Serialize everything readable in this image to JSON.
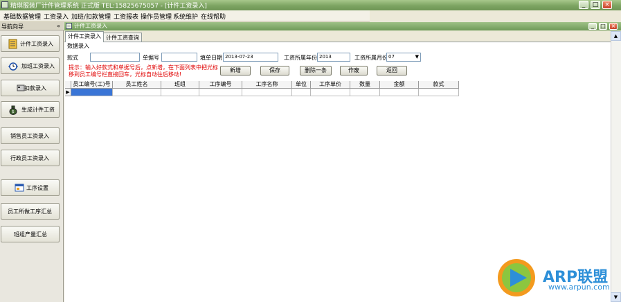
{
  "window": {
    "title": "精琪服装厂计件管理系统 正式版 TEL:15825675057 - [计件工资录入]",
    "controls": [
      "_",
      "□",
      "×"
    ]
  },
  "menu": [
    "基础数据管理",
    "工资录入",
    "加班/扣款管理",
    "工资报表",
    "操作员管理",
    "系统维护",
    "在线帮助"
  ],
  "sidebar": {
    "title": "导航向导",
    "collapse": "«",
    "items": [
      {
        "label": "计件工资录入",
        "icon": "ledger-icon"
      },
      {
        "label": "加班工资录入",
        "icon": "clock-arrows-icon"
      },
      {
        "label": "扣款录入",
        "icon": "card-icon"
      },
      {
        "label": "生成计件工资",
        "icon": "money-bag-icon"
      },
      {
        "label": "销售员工资录入",
        "icon": ""
      },
      {
        "label": "行政员工资录入",
        "icon": ""
      },
      {
        "label": "工序设置",
        "icon": "settings-window-icon"
      },
      {
        "label": "员工所做工序汇总",
        "icon": ""
      },
      {
        "label": "班组产量汇总",
        "icon": ""
      }
    ]
  },
  "inner_window": {
    "title": "计件工资录入",
    "controls": [
      "_",
      "□",
      "×"
    ]
  },
  "tabs": [
    {
      "label": "计件工资录入",
      "active": true
    },
    {
      "label": "计件工资查询",
      "active": false
    }
  ],
  "group_label": "数据录入",
  "form": {
    "style_label": "款式",
    "style_value": "",
    "doc_no_label": "单据号",
    "doc_no_value": "",
    "date_label": "填单日期",
    "date_value": "2013-07-23",
    "year_label": "工资所属年份",
    "year_value": "2013",
    "month_label": "工资所属月份",
    "month_value": "07"
  },
  "hint": "提示：输入好款式和单据号后，点新增，在下面列表中把光标移到员工编号栏直接回车，光标自动往后移动!",
  "buttons": [
    "新增",
    "保存",
    "删除一条",
    "作废",
    "返回"
  ],
  "table": {
    "columns": [
      "员工编号(工)号",
      "员工姓名",
      "班组",
      "工序编号",
      "工序名称",
      "单位",
      "工序单价",
      "数量",
      "金额",
      "款式"
    ],
    "row_marker": "▶"
  },
  "watermark": {
    "title": "ARP联盟",
    "url": "www.arpun.com",
    "colors": {
      "blue": "#2d8fd8",
      "orange": "#f39a1e",
      "green": "#8cc63f"
    }
  },
  "colors": {
    "titlebar": "#7da462",
    "hint": "#e00000",
    "selected_cell": "#3a75d6"
  }
}
